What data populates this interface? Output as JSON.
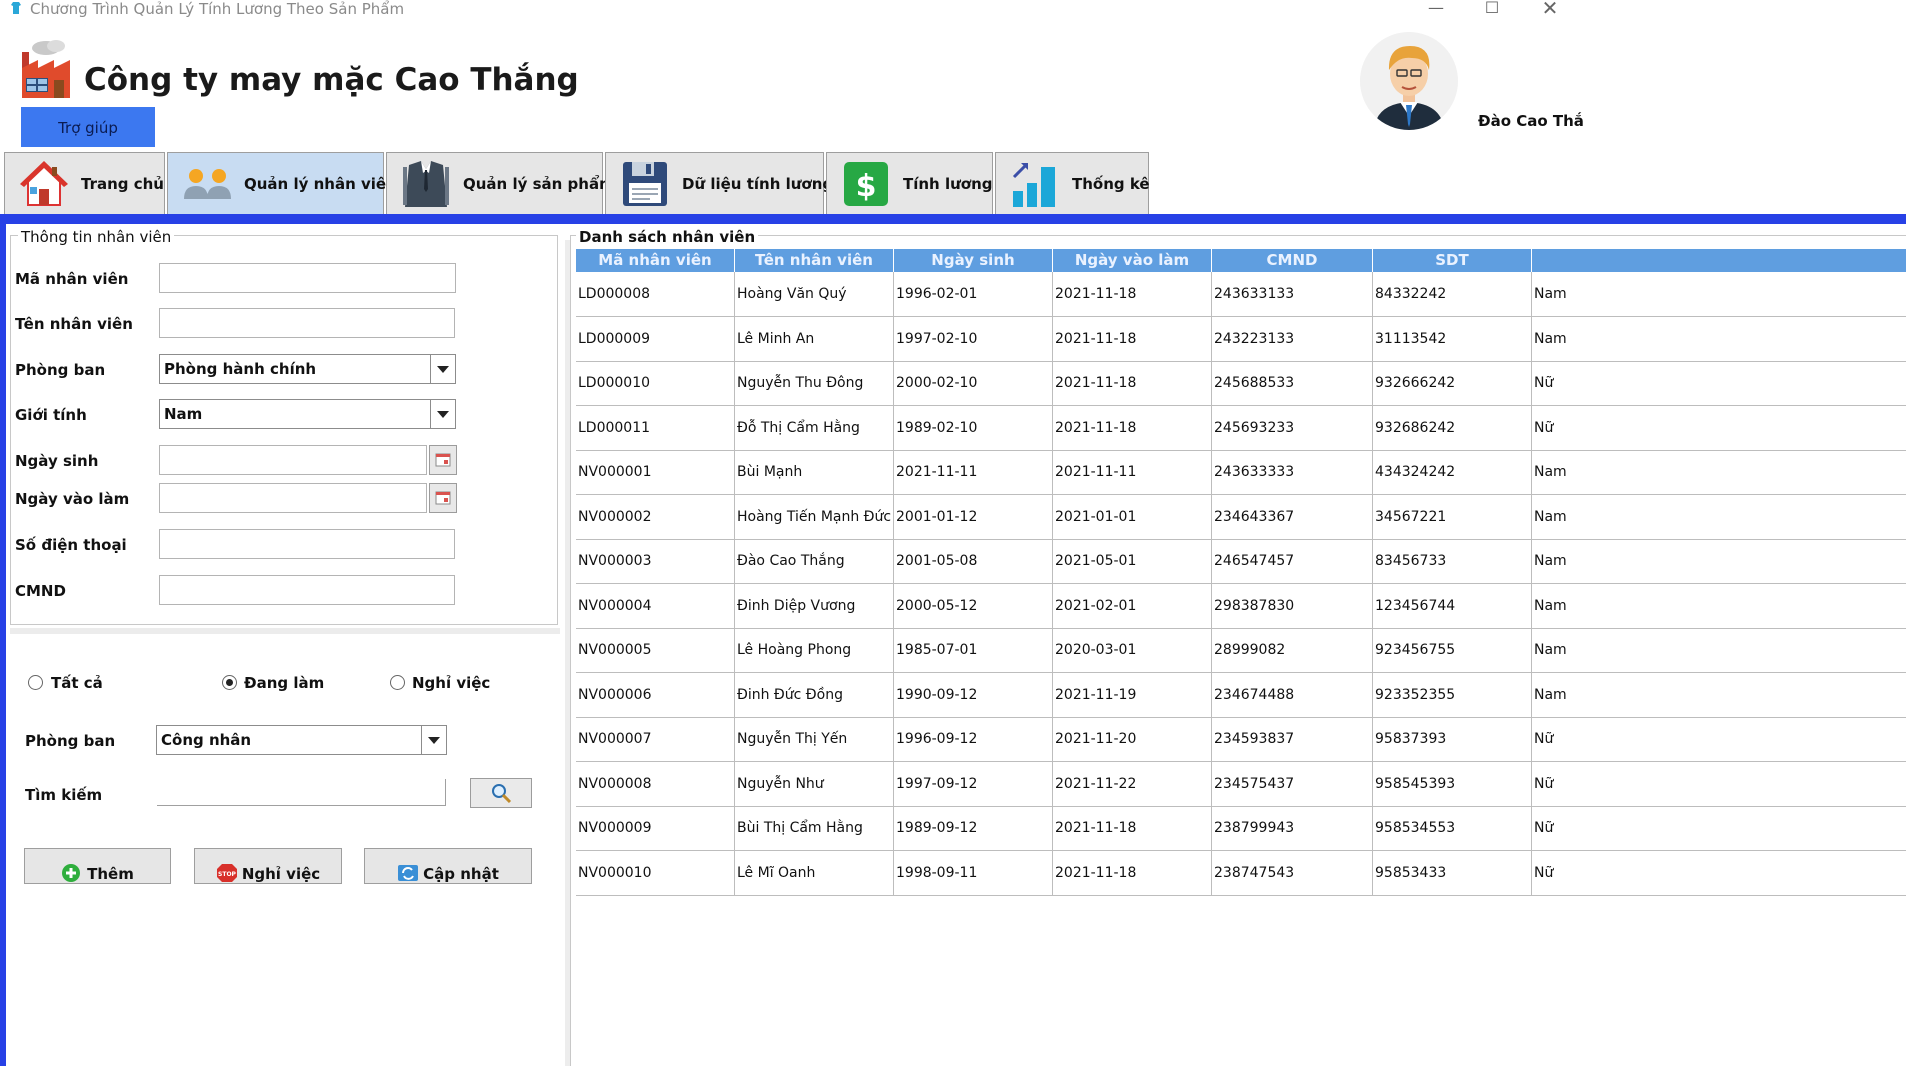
{
  "window": {
    "title": "Chương Trình Quản Lý Tính Lương Theo Sản Phẩm",
    "controls": [
      "—",
      "☐",
      "✕"
    ]
  },
  "header": {
    "company_name": "Công ty may mặc Cao Thắng",
    "help_label": "Trợ giúp",
    "user_name": "Đào Cao Thắ"
  },
  "tabs": [
    {
      "label": "Trang chủ",
      "icon": "house-icon"
    },
    {
      "label": "Quản lý nhân viên",
      "icon": "people-icon",
      "active": true
    },
    {
      "label": "Quản lý sản phẩm",
      "icon": "suit-icon"
    },
    {
      "label": "Dữ liệu tính lương",
      "icon": "floppy-disk-icon"
    },
    {
      "label": "Tính lương",
      "icon": "dollar-icon"
    },
    {
      "label": "Thống kê",
      "icon": "bar-chart-icon"
    }
  ],
  "info": {
    "legend": "Thông tin nhân viên",
    "labels": {
      "id": "Mã nhân viên",
      "name": "Tên nhân viên",
      "department": "Phòng ban",
      "gender": "Giới tính",
      "birth_date": "Ngày sinh",
      "start_date": "Ngày vào làm",
      "phone": "Số điện thoại",
      "cmnd": "CMND"
    },
    "department_value": "Phòng hành chính",
    "gender_value": "Nam"
  },
  "filter": {
    "radio_all": "Tất cả",
    "radio_working": "Đang làm",
    "radio_quit": "Nghỉ việc",
    "selected": "Đang làm",
    "department_label": "Phòng ban",
    "department_value": "Công nhân",
    "search_label": "Tìm kiếm"
  },
  "actions": {
    "add": "Thêm",
    "quit": "Nghỉ việc",
    "update": "Cập nhật"
  },
  "list": {
    "legend": "Danh sách nhân viên",
    "columns": [
      "Mã nhân viên",
      "Tên nhân viên",
      "Ngày sinh",
      "Ngày vào làm",
      "CMND",
      "SDT"
    ],
    "rows": [
      [
        "LD000008",
        "Hoàng Văn Quý",
        "1996-02-01",
        "2021-11-18",
        "243633133",
        "84332242",
        "Nam"
      ],
      [
        "LD000009",
        "Lê Minh An",
        "1997-02-10",
        "2021-11-18",
        "243223133",
        "31113542",
        "Nam"
      ],
      [
        "LD000010",
        "Nguyễn Thu Đông",
        "2000-02-10",
        "2021-11-18",
        "245688533",
        "932666242",
        "Nữ"
      ],
      [
        "LD000011",
        "Đỗ Thị Cẩm Hằng",
        "1989-02-10",
        "2021-11-18",
        "245693233",
        "932686242",
        "Nữ"
      ],
      [
        "NV000001",
        "Bùi Mạnh",
        "2021-11-11",
        "2021-11-11",
        "243633333",
        "434324242",
        "Nam"
      ],
      [
        "NV000002",
        "Hoàng Tiến Mạnh Đức",
        "2001-01-12",
        "2021-01-01",
        "234643367",
        "34567221",
        "Nam"
      ],
      [
        "NV000003",
        "Đào Cao Thắng",
        "2001-05-08",
        "2021-05-01",
        "246547457",
        "83456733",
        "Nam"
      ],
      [
        "NV000004",
        "Đinh Diệp Vương",
        "2000-05-12",
        "2021-02-01",
        "298387830",
        "123456744",
        "Nam"
      ],
      [
        "NV000005",
        "Lê Hoàng Phong",
        "1985-07-01",
        "2020-03-01",
        "28999082",
        "923456755",
        "Nam"
      ],
      [
        "NV000006",
        "Đinh Đức Đồng",
        "1990-09-12",
        "2021-11-19",
        "234674488",
        "923352355",
        "Nam"
      ],
      [
        "NV000007",
        "Nguyễn Thị Yến",
        "1996-09-12",
        "2021-11-20",
        "234593837",
        "95837393",
        "Nữ"
      ],
      [
        "NV000008",
        "Nguyễn Như",
        "1997-09-12",
        "2021-11-22",
        "234575437",
        "958545393",
        "Nữ"
      ],
      [
        "NV000009",
        "Bùi Thị Cẩm Hằng",
        "1989-09-12",
        "2021-11-18",
        "238799943",
        "958534553",
        "Nữ"
      ],
      [
        "NV000010",
        "Lê Mĩ Oanh",
        "1998-09-11",
        "2021-11-18",
        "238747543",
        "95853433",
        "Nữ"
      ]
    ]
  },
  "colors": {
    "accent_bar": "#2741e6",
    "help_button": "#3c78f0",
    "table_header": "#5f9ee0",
    "active_tab": "#c8dcf2"
  }
}
